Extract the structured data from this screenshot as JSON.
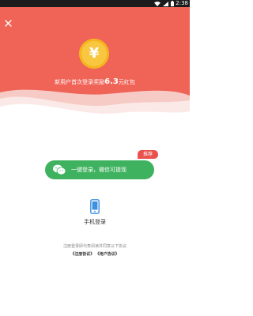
{
  "status_bar": {
    "time": "2:38",
    "icons": [
      "wifi-icon",
      "cellular-icon",
      "battery-icon"
    ]
  },
  "header": {
    "close_icon": "close-icon",
    "coin_symbol": "¥",
    "reward_prefix": "新用户首次登录奖励",
    "reward_amount": "6.3",
    "reward_suffix": "元红包"
  },
  "login": {
    "badge_label": "推荐",
    "wechat_label": "一键登录，微信可提现",
    "wechat_icon": "wechat-icon",
    "phone_icon": "phone-icon",
    "phone_label": "手机登录"
  },
  "agreement": {
    "note": "注册登录即代表阅读并同意以下协议",
    "register_link": "《注册协议》",
    "user_link": "《用户协议》"
  },
  "colors": {
    "hero": "#f06357",
    "coin": "#f9c640",
    "wechat_button": "#3fb25f",
    "badge": "#e9524d",
    "phone_icon": "#3d8fe0"
  }
}
